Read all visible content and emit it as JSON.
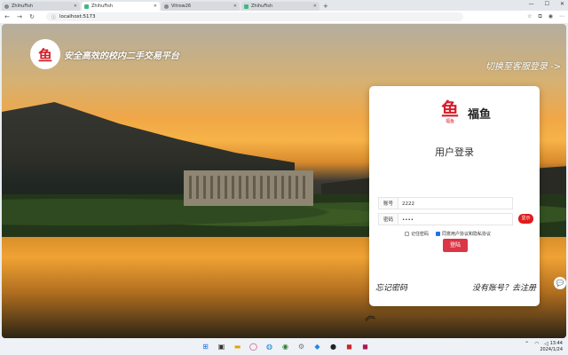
{
  "browser": {
    "tabs": [
      {
        "label": "ZhihuFish",
        "active": true
      },
      {
        "label": "ZhihuFish",
        "active": false
      },
      {
        "label": "Vitrow26",
        "active": false
      },
      {
        "label": "ZhihuFish",
        "active": false
      }
    ],
    "new_tab_label": "+",
    "url": "localhost:5173",
    "window_controls": [
      "—",
      "☐",
      "✕"
    ]
  },
  "page": {
    "brand_logo_glyph": "鱼",
    "brand_title": "安全高效的校内二手交易平台",
    "switch_link": "切换至客服登录 ->"
  },
  "login": {
    "logo_glyph": "鱼",
    "logo_caption": "福鱼",
    "brand_name": "福鱼",
    "title": "用户登录",
    "account_label": "账号",
    "account_value": "2222",
    "password_label": "密码",
    "password_value": "••••",
    "show_button": "显示",
    "remember_label": "记住密码",
    "remember_checked": false,
    "agree_label": "同意用户协议和隐私协议",
    "agree_checked": true,
    "login_button": "登陆",
    "forgot_link": "忘记密码",
    "register_link": "没有账号？去注册"
  },
  "taskbar": {
    "time": "13:44",
    "date": "2024/1/24"
  },
  "colors": {
    "accent_red": "#dc3545",
    "brand_red": "#d41e2b",
    "checkbox_blue": "#1a73e8"
  }
}
